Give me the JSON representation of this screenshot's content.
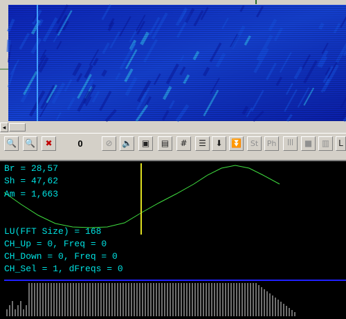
{
  "waterfall": {
    "colors": {
      "deep": "#0a1aa0",
      "mid": "#1550e0",
      "bright": "#30c0f0"
    }
  },
  "toolbar": {
    "counter_value": "0",
    "buttons": [
      {
        "name": "zoom-in-icon",
        "glyph": "🔍"
      },
      {
        "name": "zoom-out-icon",
        "glyph": "🔍"
      },
      {
        "name": "cancel-x-icon",
        "glyph": "✖"
      },
      {
        "name": "block-icon",
        "glyph": "⊘"
      },
      {
        "name": "speaker-icon",
        "glyph": "🔈"
      },
      {
        "name": "frame-icon",
        "glyph": "▣"
      },
      {
        "name": "grid-icon",
        "glyph": "▤"
      },
      {
        "name": "hash-grid-icon",
        "glyph": "#"
      },
      {
        "name": "lines-icon",
        "glyph": "☰"
      },
      {
        "name": "arrow-down-icon",
        "glyph": "⬇"
      },
      {
        "name": "double-arrow-down-icon",
        "glyph": "⏬"
      },
      {
        "name": "st-label",
        "glyph": "St"
      },
      {
        "name": "ph-label",
        "glyph": "Ph"
      },
      {
        "name": "pulse-icon",
        "glyph": "ꟾꟾꟾ"
      },
      {
        "name": "square-icon",
        "glyph": "■"
      },
      {
        "name": "bars-icon",
        "glyph": "▥"
      },
      {
        "name": "more-icon",
        "glyph": "L"
      }
    ]
  },
  "readout": {
    "br": "Br = 28,57",
    "sh": "Sh = 47,62",
    "am": "Am = 1,663",
    "lu": "LU(FFT Size) = 168",
    "ch_up": "CH_Up = 0, Freq = 0",
    "ch_down": "CH_Down = 0, Freq = 0",
    "ch_sel": "CH_Sel = 1, dFreqs = 0"
  },
  "curve": {
    "color": "#40e040",
    "marker_color": "#e0e020"
  },
  "spectrum": {
    "line_color": "#2020ff",
    "bar_color": "#e0e0e0"
  }
}
